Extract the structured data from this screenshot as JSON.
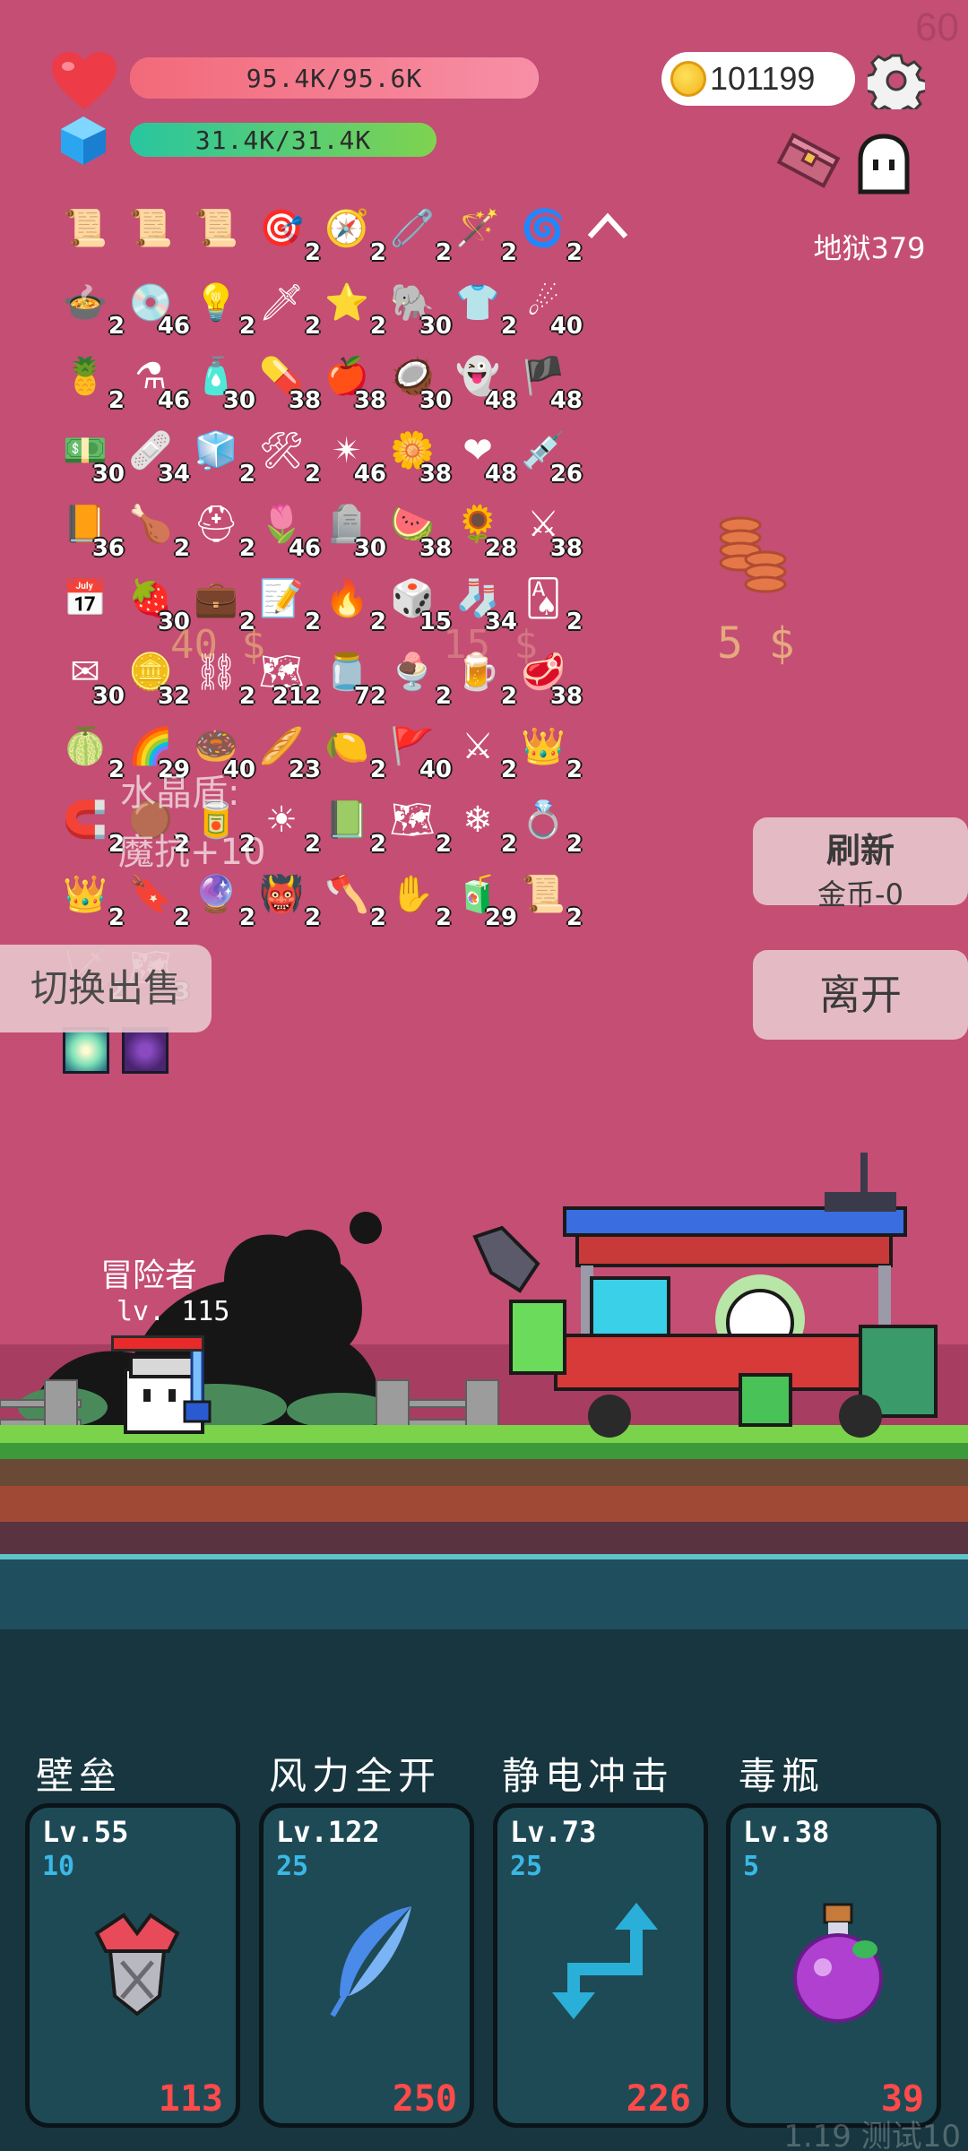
{
  "fps": "60",
  "hp": {
    "text": "95.4K/95.6K",
    "fill": 0.998
  },
  "mp": {
    "text": "31.4K/31.4K",
    "fill": 1.0
  },
  "gold": "101199",
  "stage": "地狱379",
  "inventory": [
    {
      "icon": "pink-scroll-icon",
      "glyph": "📜",
      "count": ""
    },
    {
      "icon": "pink-scroll-icon",
      "glyph": "📜",
      "count": ""
    },
    {
      "icon": "pink-scroll-icon",
      "glyph": "📜",
      "count": ""
    },
    {
      "icon": "target-icon",
      "glyph": "🎯",
      "count": "2"
    },
    {
      "icon": "compass-icon",
      "glyph": "🧭",
      "count": "2"
    },
    {
      "icon": "safety-pin-icon",
      "glyph": "🧷",
      "count": "2"
    },
    {
      "icon": "magic-wand-icon",
      "glyph": "🪄",
      "count": "2"
    },
    {
      "icon": "spiral-icon",
      "glyph": "🌀",
      "count": "2"
    },
    {
      "icon": "cauldron-icon",
      "glyph": "🍲",
      "count": "2"
    },
    {
      "icon": "disc-icon",
      "glyph": "💿",
      "count": "46"
    },
    {
      "icon": "light-bulb-icon",
      "glyph": "💡",
      "count": "2"
    },
    {
      "icon": "sword-icon",
      "glyph": "🗡",
      "count": "2"
    },
    {
      "icon": "star-card-icon",
      "glyph": "⭐",
      "count": "2"
    },
    {
      "icon": "elephant-icon",
      "glyph": "🐘",
      "count": "30"
    },
    {
      "icon": "shirt-icon",
      "glyph": "👕",
      "count": "2"
    },
    {
      "icon": "meteor-icon",
      "glyph": "☄",
      "count": "40"
    },
    {
      "icon": "pineapple-icon",
      "glyph": "🍍",
      "count": "2"
    },
    {
      "icon": "potion-flask-icon",
      "glyph": "⚗",
      "count": "46"
    },
    {
      "icon": "spray-bottle-icon",
      "glyph": "🧴",
      "count": "30"
    },
    {
      "icon": "pill-icon",
      "glyph": "💊",
      "count": "38"
    },
    {
      "icon": "apple-icon",
      "glyph": "🍎",
      "count": "38"
    },
    {
      "icon": "coconut-icon",
      "glyph": "🥥",
      "count": "30"
    },
    {
      "icon": "ghost-icon",
      "glyph": "👻",
      "count": "48"
    },
    {
      "icon": "pirate-ship-icon",
      "glyph": "🏴",
      "count": "48"
    },
    {
      "icon": "money-icon",
      "glyph": "💵",
      "count": "30"
    },
    {
      "icon": "eraser-icon",
      "glyph": "🩹",
      "count": "34"
    },
    {
      "icon": "ice-block-icon",
      "glyph": "🧊",
      "count": "2"
    },
    {
      "icon": "tools-icon",
      "glyph": "🛠",
      "count": "2"
    },
    {
      "icon": "spiked-ball-icon",
      "glyph": "✴",
      "count": "46"
    },
    {
      "icon": "flower-icon",
      "glyph": "🌼",
      "count": "38"
    },
    {
      "icon": "heart-icon",
      "glyph": "❤",
      "count": "48"
    },
    {
      "icon": "syringe-icon",
      "glyph": "💉",
      "count": "26"
    },
    {
      "icon": "book-icon",
      "glyph": "📙",
      "count": "36"
    },
    {
      "icon": "drumstick-icon",
      "glyph": "🍗",
      "count": "2"
    },
    {
      "icon": "helmet-icon",
      "glyph": "⛑",
      "count": "2"
    },
    {
      "icon": "tulip-icon",
      "glyph": "🌷",
      "count": "46"
    },
    {
      "icon": "tombstone-icon",
      "glyph": "🪦",
      "count": "30"
    },
    {
      "icon": "watermelon-icon",
      "glyph": "🍉",
      "count": "38"
    },
    {
      "icon": "sunflower-icon",
      "glyph": "🌻",
      "count": "28"
    },
    {
      "icon": "broadsword-icon",
      "glyph": "⚔",
      "count": "38"
    },
    {
      "icon": "calendar-heart-icon",
      "glyph": "📅",
      "count": ""
    },
    {
      "icon": "strawberry-icon",
      "glyph": "🍓",
      "count": "30"
    },
    {
      "icon": "briefcase-icon",
      "glyph": "💼",
      "count": "2"
    },
    {
      "icon": "note-pencil-icon",
      "glyph": "📝",
      "count": "2"
    },
    {
      "icon": "fire-icon",
      "glyph": "🔥",
      "count": "2"
    },
    {
      "icon": "dice-icon",
      "glyph": "🎲",
      "count": "15"
    },
    {
      "icon": "sock-icon",
      "glyph": "🧦",
      "count": "34"
    },
    {
      "icon": "playing-card-icon",
      "glyph": "🂡",
      "count": "2"
    },
    {
      "icon": "envelope-icon",
      "glyph": "✉",
      "count": "30"
    },
    {
      "icon": "coin-stack-icon",
      "glyph": "🪙",
      "count": "32"
    },
    {
      "icon": "chain-icon",
      "glyph": "⛓",
      "count": "2"
    },
    {
      "icon": "map-scroll-icon",
      "glyph": "🗺",
      "count": "212"
    },
    {
      "icon": "jam-jar-icon",
      "glyph": "🫙",
      "count": "72"
    },
    {
      "icon": "sundae-icon",
      "glyph": "🍨",
      "count": "2"
    },
    {
      "icon": "beer-icon",
      "glyph": "🍺",
      "count": "2"
    },
    {
      "icon": "meat-icon",
      "glyph": "🥩",
      "count": "38"
    },
    {
      "icon": "durian-icon",
      "glyph": "🍈",
      "count": "2"
    },
    {
      "icon": "rainbow-icon",
      "glyph": "🌈",
      "count": "29"
    },
    {
      "icon": "donut-icon",
      "glyph": "🍩",
      "count": "40"
    },
    {
      "icon": "bread-icon",
      "glyph": "🥖",
      "count": "23"
    },
    {
      "icon": "lime-icon",
      "glyph": "🍋",
      "count": "2"
    },
    {
      "icon": "flag-icon",
      "glyph": "🚩",
      "count": "40"
    },
    {
      "icon": "crossed-swords-icon",
      "glyph": "⚔",
      "count": "2"
    },
    {
      "icon": "crown-icon",
      "glyph": "👑",
      "count": "2"
    },
    {
      "icon": "magnet-icon",
      "glyph": "🧲",
      "count": "2"
    },
    {
      "icon": "brown-orb-icon",
      "glyph": "🟤",
      "count": "2"
    },
    {
      "icon": "blue-cylinder-icon",
      "glyph": "🥫",
      "count": "2"
    },
    {
      "icon": "sun-orb-icon",
      "glyph": "☀",
      "count": "2"
    },
    {
      "icon": "green-tablet-icon",
      "glyph": "📗",
      "count": "2"
    },
    {
      "icon": "treasure-map-icon",
      "glyph": "🗺",
      "count": "2"
    },
    {
      "icon": "snowflake-icon",
      "glyph": "❄",
      "count": "2"
    },
    {
      "icon": "ring-icon",
      "glyph": "💍",
      "count": "2"
    },
    {
      "icon": "crown-icon",
      "glyph": "👑",
      "count": "2"
    },
    {
      "icon": "bookmark-icon",
      "glyph": "🔖",
      "count": "2"
    },
    {
      "icon": "crystal-ball-icon",
      "glyph": "🔮",
      "count": "2"
    },
    {
      "icon": "demon-face-icon",
      "glyph": "👹",
      "count": "2"
    },
    {
      "icon": "axe-icon",
      "glyph": "🪓",
      "count": "2"
    },
    {
      "icon": "glove-icon",
      "glyph": "✋",
      "count": "2"
    },
    {
      "icon": "bandage-can-icon",
      "glyph": "🧃",
      "count": "29"
    },
    {
      "icon": "parchment-icon",
      "glyph": "📜",
      "count": "2"
    },
    {
      "icon": "bow-icon",
      "glyph": "🏹",
      "count": "2"
    },
    {
      "icon": "old-map-icon",
      "glyph": "🗺",
      "count": "3"
    }
  ],
  "floating": {
    "price_left": "40 $",
    "price_mid": "15 $",
    "crystal_label": "水晶盾:",
    "crystal_effect": "魔抗+10"
  },
  "price_right": "5 $",
  "buttons": {
    "refresh_title": "刷新",
    "refresh_cost": "金币-0",
    "leave": "离开",
    "switch_sell": "切换出售"
  },
  "hero": {
    "name": "冒险者",
    "level": "lv. 115",
    "hp_fill": 0.95
  },
  "skills": [
    {
      "name": "壁垒",
      "level": "Lv.55",
      "sub": "10",
      "cost": "113",
      "icon": "armor-icon"
    },
    {
      "name": "风力全开",
      "level": "Lv.122",
      "sub": "25",
      "cost": "250",
      "icon": "feather-icon"
    },
    {
      "name": "静电冲击",
      "level": "Lv.73",
      "sub": "25",
      "cost": "226",
      "icon": "zigzag-arrow-icon"
    },
    {
      "name": "毒瓶",
      "level": "Lv.38",
      "sub": "5",
      "cost": "39",
      "icon": "poison-bottle-icon"
    }
  ],
  "version": "1.19 测试10",
  "colors": {
    "background": "#c44e74",
    "skill_panel": "#17363f",
    "cost_red": "#ff4a4a",
    "sub_blue": "#3ab8e6"
  }
}
